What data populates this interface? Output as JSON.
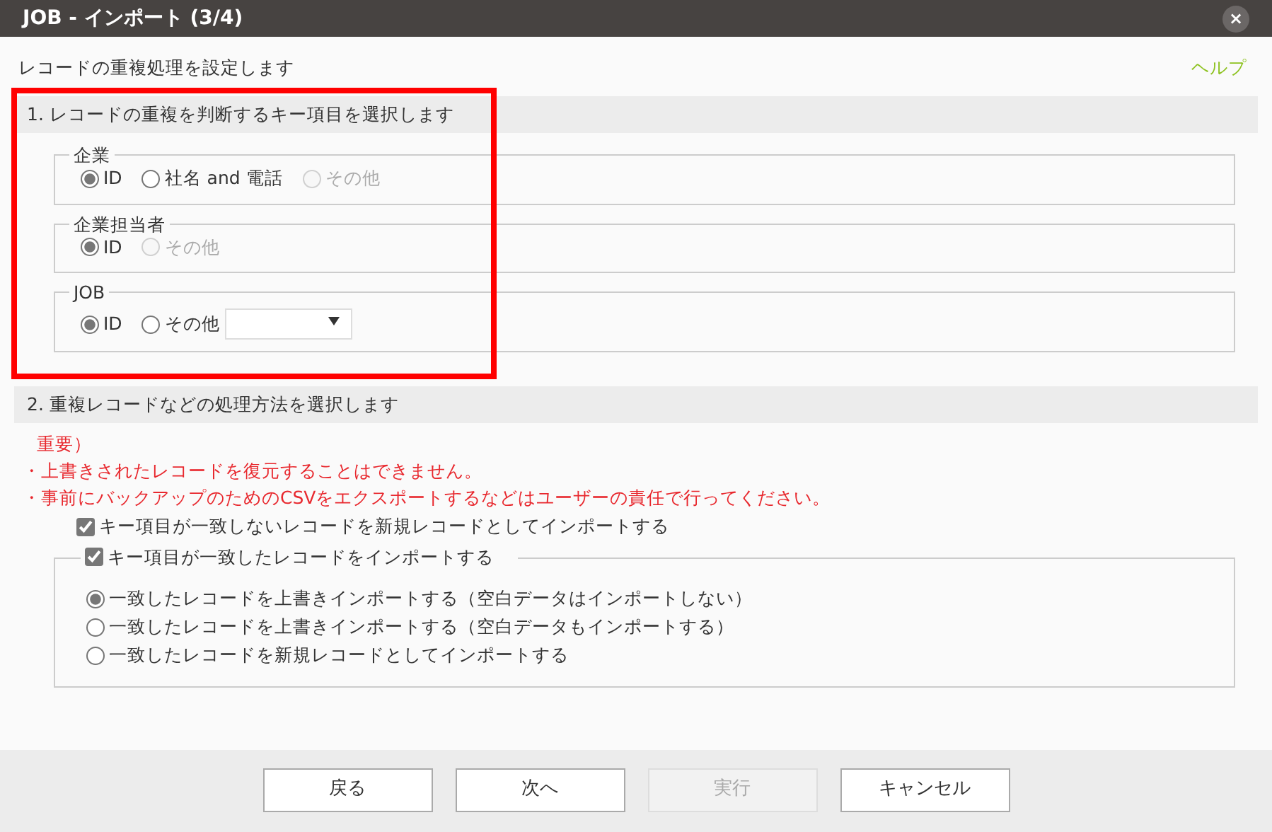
{
  "window": {
    "title": "JOB - インポート (3/4)",
    "close_label": "×"
  },
  "intro": "レコードの重複処理を設定します",
  "help_link": "ヘルプ",
  "section1": {
    "heading": "1. レコードの重複を判断するキー項目を選択します",
    "highlighted": true,
    "groups": [
      {
        "legend": "企業",
        "options": [
          {
            "label": "ID",
            "selected": true,
            "disabled": false
          },
          {
            "label": "社名 and 電話",
            "selected": false,
            "disabled": false
          },
          {
            "label": "その他",
            "selected": false,
            "disabled": true
          }
        ]
      },
      {
        "legend": "企業担当者",
        "options": [
          {
            "label": "ID",
            "selected": true,
            "disabled": false
          },
          {
            "label": "その他",
            "selected": false,
            "disabled": true
          }
        ]
      },
      {
        "legend": "JOB",
        "dropdown": true,
        "options": [
          {
            "label": "ID",
            "selected": true,
            "disabled": false
          },
          {
            "label": "その他",
            "selected": false,
            "disabled": false
          }
        ]
      }
    ]
  },
  "section2": {
    "heading": "2. 重複レコードなどの処理方法を選択します",
    "warning_lines": [
      "重要）",
      "・上書きされたレコードを復元することはできません。",
      "・事前にバックアップのためのCSVをエクスポートするなどはユーザーの責任で行ってください。"
    ],
    "new_record_checkbox": {
      "label": "キー項目が一致しないレコードを新規レコードとしてインポートする",
      "checked": true
    },
    "matched_group": {
      "label": "キー項目が一致したレコードをインポートする",
      "checked": true,
      "options": [
        {
          "label": "一致したレコードを上書きインポートする（空白データはインポートしない）",
          "selected": true
        },
        {
          "label": "一致したレコードを上書きインポートする（空白データもインポートする）",
          "selected": false
        },
        {
          "label": "一致したレコードを新規レコードとしてインポートする",
          "selected": false
        }
      ]
    }
  },
  "buttons": [
    {
      "label": "戻る",
      "disabled": false
    },
    {
      "label": "次へ",
      "disabled": false
    },
    {
      "label": "実行",
      "disabled": true
    },
    {
      "label": "キャンセル",
      "disabled": false
    }
  ]
}
